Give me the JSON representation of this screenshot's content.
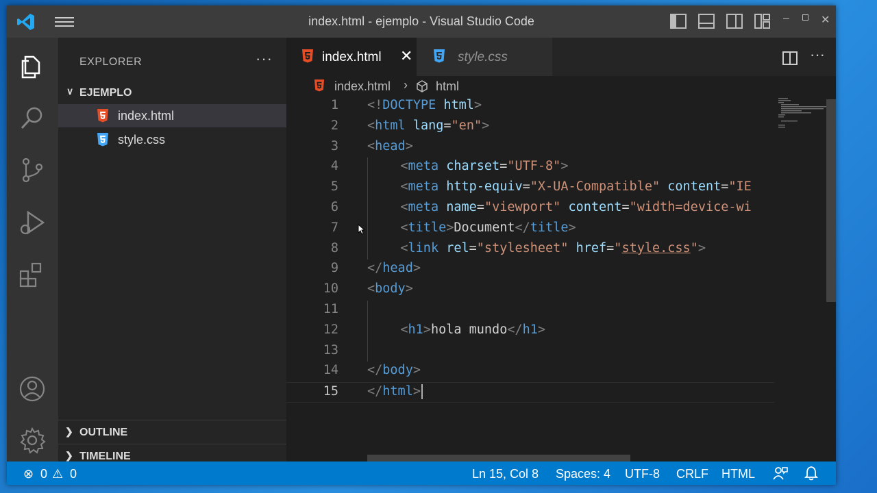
{
  "window": {
    "title": "index.html - ejemplo - Visual Studio Code"
  },
  "titlebar": {
    "controls": [
      "layout-icon",
      "panel-icon",
      "split-icon",
      "customize-layout-icon",
      "minimize-icon",
      "maximize-icon",
      "close-icon"
    ]
  },
  "sidebar": {
    "title": "EXPLORER",
    "folder": "EJEMPLO",
    "files": [
      {
        "name": "index.html",
        "type": "html"
      },
      {
        "name": "style.css",
        "type": "css"
      }
    ],
    "sections": [
      "OUTLINE",
      "TIMELINE"
    ]
  },
  "tabs": [
    {
      "label": "index.html",
      "active": true
    },
    {
      "label": "style.css",
      "active": false
    }
  ],
  "breadcrumb": {
    "file": "index.html",
    "symbol": "html"
  },
  "code": [
    {
      "n": "1",
      "indent": 0,
      "tokens": [
        [
          "br",
          "<!"
        ],
        [
          "tag",
          "DOCTYPE"
        ],
        [
          "txt",
          " "
        ],
        [
          "attr",
          "html"
        ],
        [
          "br",
          ">"
        ]
      ]
    },
    {
      "n": "2",
      "indent": 0,
      "tokens": [
        [
          "br",
          "<"
        ],
        [
          "tag",
          "html"
        ],
        [
          "txt",
          " "
        ],
        [
          "attr",
          "lang"
        ],
        [
          "txt",
          "="
        ],
        [
          "str",
          "\"en\""
        ],
        [
          "br",
          ">"
        ]
      ]
    },
    {
      "n": "3",
      "indent": 0,
      "tokens": [
        [
          "br",
          "<"
        ],
        [
          "tag",
          "head"
        ],
        [
          "br",
          ">"
        ]
      ]
    },
    {
      "n": "4",
      "indent": 1,
      "tokens": [
        [
          "br",
          "<"
        ],
        [
          "tag",
          "meta"
        ],
        [
          "txt",
          " "
        ],
        [
          "attr",
          "charset"
        ],
        [
          "txt",
          "="
        ],
        [
          "str",
          "\"UTF-8\""
        ],
        [
          "br",
          ">"
        ]
      ]
    },
    {
      "n": "5",
      "indent": 1,
      "tokens": [
        [
          "br",
          "<"
        ],
        [
          "tag",
          "meta"
        ],
        [
          "txt",
          " "
        ],
        [
          "attr",
          "http-equiv"
        ],
        [
          "txt",
          "="
        ],
        [
          "str",
          "\"X-UA-Compatible\""
        ],
        [
          "txt",
          " "
        ],
        [
          "attr",
          "content"
        ],
        [
          "txt",
          "="
        ],
        [
          "str",
          "\"IE"
        ]
      ]
    },
    {
      "n": "6",
      "indent": 1,
      "tokens": [
        [
          "br",
          "<"
        ],
        [
          "tag",
          "meta"
        ],
        [
          "txt",
          " "
        ],
        [
          "attr",
          "name"
        ],
        [
          "txt",
          "="
        ],
        [
          "str",
          "\"viewport\""
        ],
        [
          "txt",
          " "
        ],
        [
          "attr",
          "content"
        ],
        [
          "txt",
          "="
        ],
        [
          "str",
          "\"width=device-wi"
        ]
      ]
    },
    {
      "n": "7",
      "indent": 1,
      "tokens": [
        [
          "br",
          "<"
        ],
        [
          "tag",
          "title"
        ],
        [
          "br",
          ">"
        ],
        [
          "txt",
          "Document"
        ],
        [
          "br",
          "</"
        ],
        [
          "tag",
          "title"
        ],
        [
          "br",
          ">"
        ]
      ]
    },
    {
      "n": "8",
      "indent": 1,
      "tokens": [
        [
          "br",
          "<"
        ],
        [
          "tag",
          "link"
        ],
        [
          "txt",
          " "
        ],
        [
          "attr",
          "rel"
        ],
        [
          "txt",
          "="
        ],
        [
          "str",
          "\"stylesheet\""
        ],
        [
          "txt",
          " "
        ],
        [
          "attr",
          "href"
        ],
        [
          "txt",
          "="
        ],
        [
          "str",
          "\""
        ],
        [
          "link",
          "style.css"
        ],
        [
          "str",
          "\""
        ],
        [
          "br",
          ">"
        ]
      ]
    },
    {
      "n": "9",
      "indent": 0,
      "tokens": [
        [
          "br",
          "</"
        ],
        [
          "tag",
          "head"
        ],
        [
          "br",
          ">"
        ]
      ]
    },
    {
      "n": "10",
      "indent": 0,
      "tokens": [
        [
          "br",
          "<"
        ],
        [
          "tag",
          "body"
        ],
        [
          "br",
          ">"
        ]
      ]
    },
    {
      "n": "11",
      "indent": 0,
      "tokens": []
    },
    {
      "n": "12",
      "indent": 1,
      "tokens": [
        [
          "br",
          "<"
        ],
        [
          "tag",
          "h1"
        ],
        [
          "br",
          ">"
        ],
        [
          "txt",
          "hola mundo"
        ],
        [
          "br",
          "</"
        ],
        [
          "tag",
          "h1"
        ],
        [
          "br",
          ">"
        ]
      ]
    },
    {
      "n": "13",
      "indent": 0,
      "tokens": []
    },
    {
      "n": "14",
      "indent": 0,
      "tokens": [
        [
          "br",
          "</"
        ],
        [
          "tag",
          "body"
        ],
        [
          "br",
          ">"
        ]
      ]
    },
    {
      "n": "15",
      "indent": 0,
      "tokens": [
        [
          "br",
          "</"
        ],
        [
          "tag",
          "html"
        ],
        [
          "br",
          ">"
        ]
      ],
      "current": true
    }
  ],
  "status": {
    "errors": "0",
    "warnings": "0",
    "position": "Ln 15, Col 8",
    "spaces": "Spaces: 4",
    "encoding": "UTF-8",
    "eol": "CRLF",
    "language": "HTML"
  },
  "colors": {
    "accent": "#007acc",
    "html": "#e44d26",
    "css": "#42a5f5"
  }
}
